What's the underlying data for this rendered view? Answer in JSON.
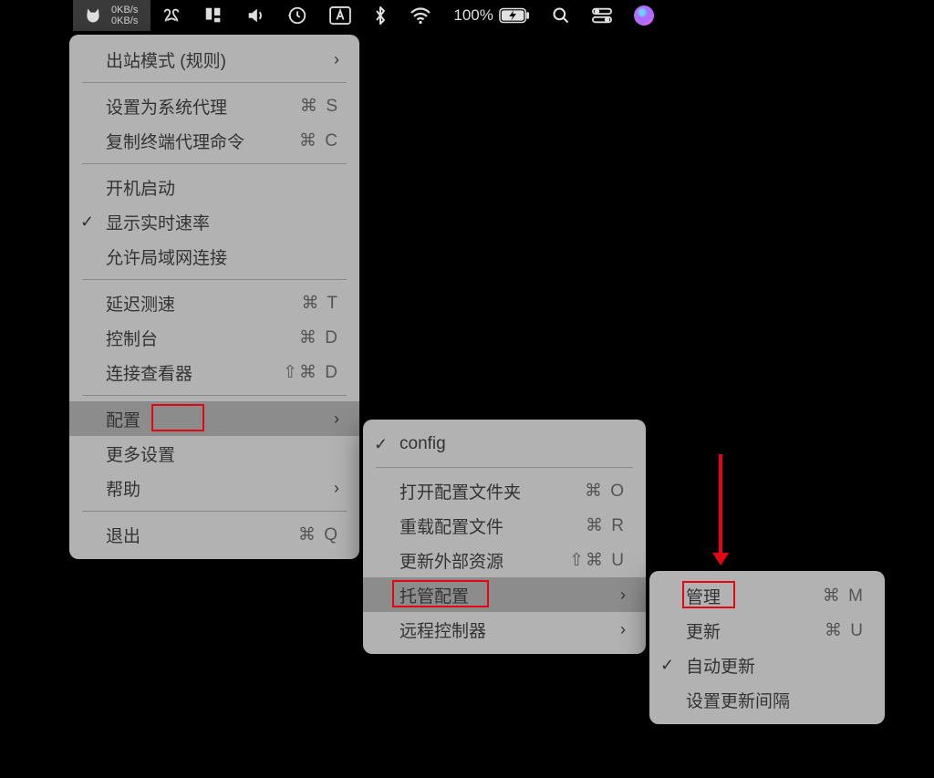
{
  "menubar": {
    "speed_up": "0KB/s",
    "speed_down": "0KB/s",
    "battery_percent": "100%"
  },
  "menu1": {
    "outbound_mode": "出站模式 (规则)",
    "set_system_proxy": "设置为系统代理",
    "set_system_proxy_sc": "⌘ S",
    "copy_terminal_cmd": "复制终端代理命令",
    "copy_terminal_cmd_sc": "⌘ C",
    "autostart": "开机启动",
    "show_speed": "显示实时速率",
    "allow_lan": "允许局域网连接",
    "latency_test": "延迟测速",
    "latency_test_sc": "⌘ T",
    "console": "控制台",
    "console_sc": "⌘ D",
    "conn_viewer": "连接查看器",
    "conn_viewer_sc": "⇧⌘ D",
    "config": "配置",
    "more_settings": "更多设置",
    "help": "帮助",
    "quit": "退出",
    "quit_sc": "⌘ Q"
  },
  "menu2": {
    "active_config": "config",
    "open_folder": "打开配置文件夹",
    "open_folder_sc": "⌘ O",
    "reload_config": "重载配置文件",
    "reload_config_sc": "⌘ R",
    "update_external": "更新外部资源",
    "update_external_sc": "⇧⌘ U",
    "managed_config": "托管配置",
    "remote_controller": "远程控制器"
  },
  "menu3": {
    "manage": "管理",
    "manage_sc": "⌘ M",
    "update": "更新",
    "update_sc": "⌘ U",
    "auto_update": "自动更新",
    "set_interval": "设置更新间隔"
  }
}
